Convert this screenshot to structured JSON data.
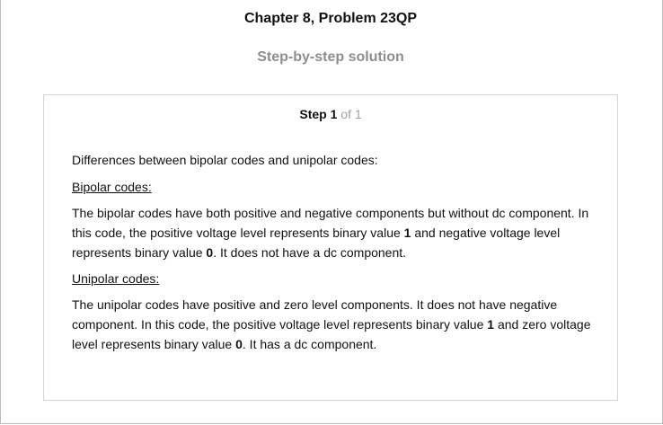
{
  "header": {
    "chapter_title": "Chapter 8, Problem 23QP",
    "subtitle": "Step-by-step solution"
  },
  "step": {
    "label": "Step",
    "number": "1",
    "of_text": "of 1"
  },
  "content": {
    "intro": "Differences between bipolar codes and unipolar codes:",
    "bipolar": {
      "heading": "Bipolar codes:",
      "text_1": "The bipolar codes have both positive and negative components but without dc component. In this code, the positive voltage level represents binary value ",
      "bold_1": "1",
      "text_2": " and negative voltage level represents binary value ",
      "bold_2": "0",
      "text_3": ". It does not have a dc component."
    },
    "unipolar": {
      "heading": "Unipolar codes:",
      "text_1": "The unipolar codes have positive and zero level components. It does not have negative component. In this code, the positive voltage level represents binary value ",
      "bold_1": "1",
      "text_2": " and zero voltage level represents binary value ",
      "bold_2": "0",
      "text_3": ". It has a dc component."
    }
  }
}
